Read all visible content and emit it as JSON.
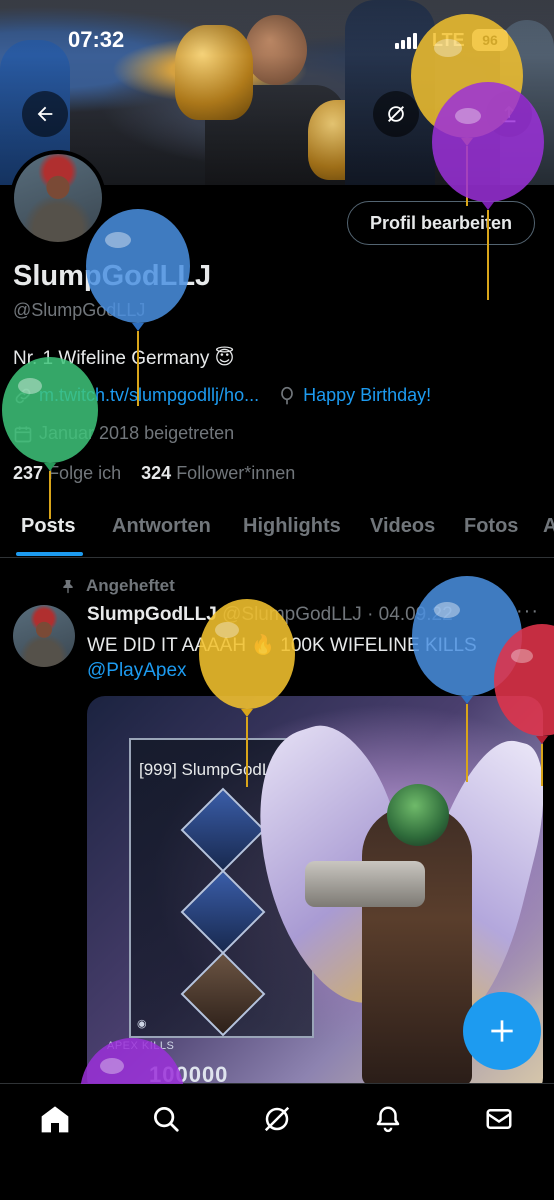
{
  "status_bar": {
    "time": "07:32",
    "network": "LTE",
    "battery": "96"
  },
  "profile": {
    "edit_button": "Profil bearbeiten",
    "display_name": "SlumpGodLLJ",
    "handle": "@SlumpGodLLJ",
    "bio": "Nr. 1 Wifeline Germany 😇",
    "link": "m.twitch.tv/slumpgodllj/ho...",
    "birthday": "Happy Birthday!",
    "joined": "Januar 2018 beigetreten",
    "following_count": "237",
    "following_label": "Folge ich",
    "followers_count": "324",
    "followers_label": "Follower*innen"
  },
  "tabs": [
    "Posts",
    "Antworten",
    "Highlights",
    "Videos",
    "Fotos",
    "A"
  ],
  "post": {
    "pinned_label": "Angeheftet",
    "author": "SlumpGodLLJ",
    "handle_date": "@SlumpGodLLJ · 04.09.22",
    "text": "WE DID IT AAAAH 🔥 100K WIFELINE KILLS",
    "mention": "@PlayApex",
    "media": {
      "card_title": "[999] SlumpGodLLJ",
      "kills_label": "APEX KILLS",
      "kills_value": "100000"
    }
  },
  "icons": {
    "back": "back-arrow-icon",
    "grok_banner": "grok-icon",
    "share": "share-icon",
    "link": "link-icon",
    "balloon": "balloon-icon",
    "calendar": "calendar-icon",
    "pin": "pin-icon",
    "more": "more-icon",
    "compose": "plus-icon",
    "nav": [
      "home-icon",
      "search-icon",
      "grok-icon",
      "bell-icon",
      "mail-icon"
    ]
  },
  "colors": {
    "accent": "#1d9bf0",
    "muted": "#71767b",
    "text": "#e7e9ea",
    "border": "#2f3336"
  },
  "overlay_balloons": [
    "#f2c12e",
    "#9b30d9",
    "#4a90e2",
    "#3ec47a",
    "#f2c12e",
    "#4a90e2",
    "#e0334a",
    "#9b30d9"
  ]
}
